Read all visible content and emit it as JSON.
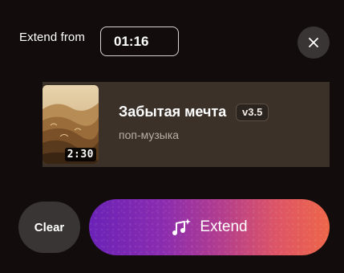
{
  "header": {
    "extend_from_label": "Extend from",
    "time_value": "01:16"
  },
  "close": {
    "icon": "close-icon"
  },
  "song": {
    "title": "Забытая мечта",
    "version": "v3.5",
    "genre": "поп-музыка",
    "duration": "2:30",
    "cover_icon": "cover-art-image"
  },
  "actions": {
    "clear_label": "Clear",
    "extend_label": "Extend",
    "extend_icon": "music-note-sparkle-icon"
  },
  "colors": {
    "background": "#120d0c",
    "card": "#3b3129",
    "button_dark": "#3a3535",
    "gradient_start": "#6a22b6",
    "gradient_end": "#ee6648"
  }
}
